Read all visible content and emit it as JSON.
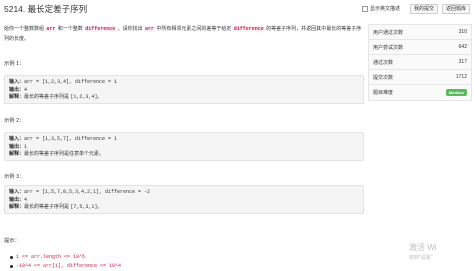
{
  "header": {
    "title": "5214. 最长定差子序列",
    "toggle_label": "显示英文描述",
    "my_submissions": "我的提交",
    "back_to_problems": "返回题库"
  },
  "description": {
    "part1": "给你一个整数数组 ",
    "code1": "arr",
    "part2": " 和一个整数 ",
    "code2": "difference",
    "part3": " ，请你找出 ",
    "code3": "arr",
    "part4": " 中所有相邻元素之间的差等于给定 ",
    "code4": "difference",
    "part5": " 的等差子序列，并返回其中最长的等差子序列的长度。"
  },
  "examples": [
    {
      "title": "示例 1：",
      "input_label": "输入：",
      "input_value": "arr = [1,2,3,4], difference = 1",
      "output_label": "输出：",
      "output_value": "4",
      "explain_label": "解释：",
      "explain_text": "最长的等差子序列是 ",
      "explain_code": "[1,2,3,4]",
      "explain_tail": "。"
    },
    {
      "title": "示例 2：",
      "input_label": "输入：",
      "input_value": "arr = [1,3,5,7], difference = 1",
      "output_label": "输出：",
      "output_value": "1",
      "explain_label": "解释：",
      "explain_text": "最长的等差子序列是任意单个元素。",
      "explain_code": "",
      "explain_tail": ""
    },
    {
      "title": "示例 3：",
      "input_label": "输入：",
      "input_value": "arr = [1,5,7,8,5,3,4,2,1], difference = -2",
      "output_label": "输出：",
      "output_value": "4",
      "explain_label": "解释：",
      "explain_text": "最长的等差子序列是 ",
      "explain_code": "[7,5,3,1]",
      "explain_tail": "。"
    }
  ],
  "stats": [
    {
      "label": "用户通过次数",
      "value": "310"
    },
    {
      "label": "用户尝试次数",
      "value": "642"
    },
    {
      "label": "通过次数",
      "value": "317"
    },
    {
      "label": "提交次数",
      "value": "1712"
    },
    {
      "label": "题目难度",
      "value": "Medium"
    }
  ],
  "hints": {
    "title": "提示：",
    "items": [
      "1 <= arr.length <= 10^5",
      "-10^4 <= arr[i], difference <= 10^4"
    ]
  },
  "watermark": {
    "line1": "激活 Wi",
    "line2": "转到\"设置\""
  },
  "colors": {
    "code_text": "#c7254e",
    "code_bg": "#f9f2f4",
    "difficulty_badge": "#5cb85c",
    "example_bg": "#f5f5f5"
  }
}
